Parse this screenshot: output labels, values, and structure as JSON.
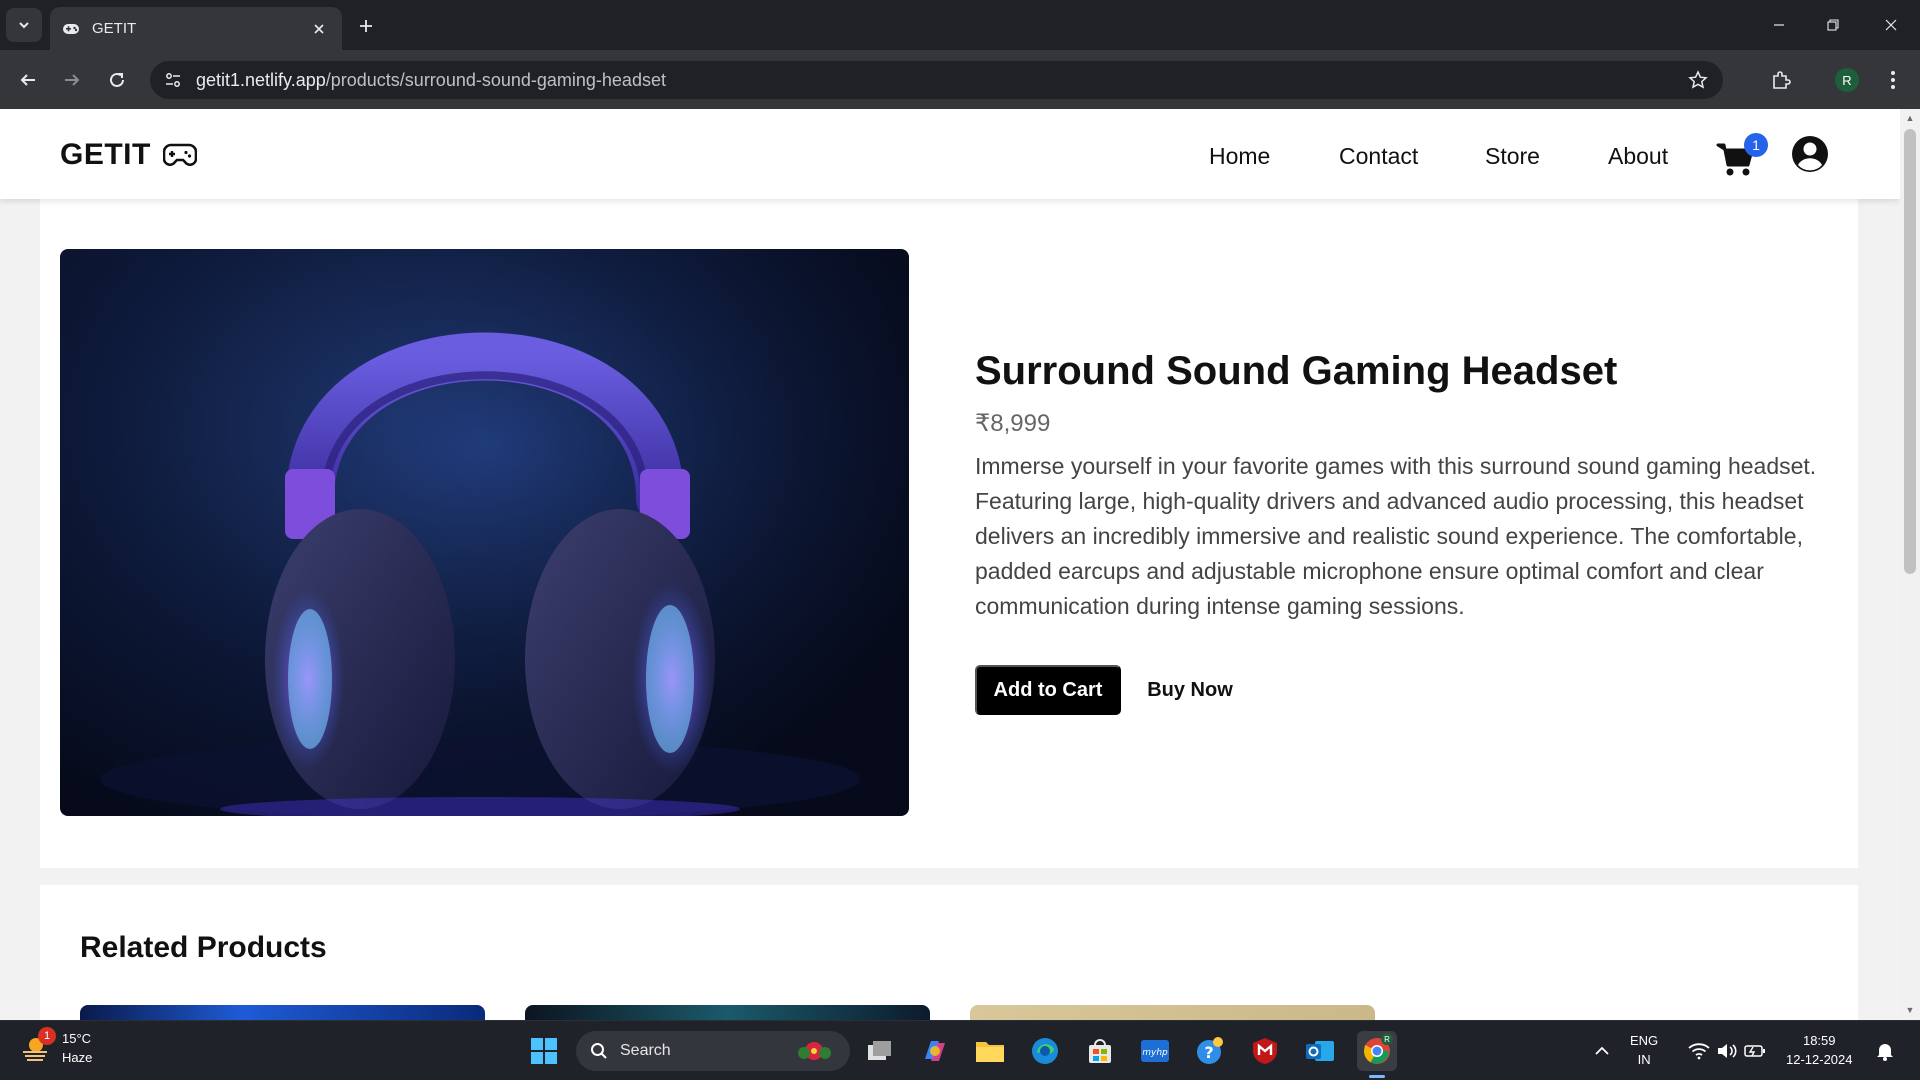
{
  "browser": {
    "tab_title": "GETIT",
    "url_host": "getit1.netlify.app",
    "url_path": "/products/surround-sound-gaming-headset",
    "profile_initial": "R"
  },
  "site": {
    "logo_text": "GETIT",
    "nav": [
      {
        "label": "Home"
      },
      {
        "label": "Contact"
      },
      {
        "label": "Store"
      },
      {
        "label": "About"
      }
    ],
    "cart_count": "1"
  },
  "product": {
    "title": "Surround Sound Gaming Headset",
    "price": "₹8,999",
    "description": "Immerse yourself in your favorite games with this surround sound gaming headset. Featuring large, high-quality drivers and advanced audio processing, this headset delivers an incredibly immersive and realistic sound experience. The comfortable, padded earcups and adjustable microphone ensure optimal comfort and clear communication during intense gaming sessions.",
    "add_to_cart_label": "Add to Cart",
    "buy_now_label": "Buy Now"
  },
  "related": {
    "title": "Related Products"
  },
  "taskbar": {
    "weather_badge": "1",
    "temperature": "15°C",
    "condition": "Haze",
    "search_placeholder": "Search",
    "lang_top": "ENG",
    "lang_bottom": "IN",
    "time": "18:59",
    "date": "12-12-2024",
    "chrome_badge": "R"
  },
  "colors": {
    "accent_badge": "#2563eb",
    "primary_button": "#000000",
    "browser_frame": "#202124"
  }
}
